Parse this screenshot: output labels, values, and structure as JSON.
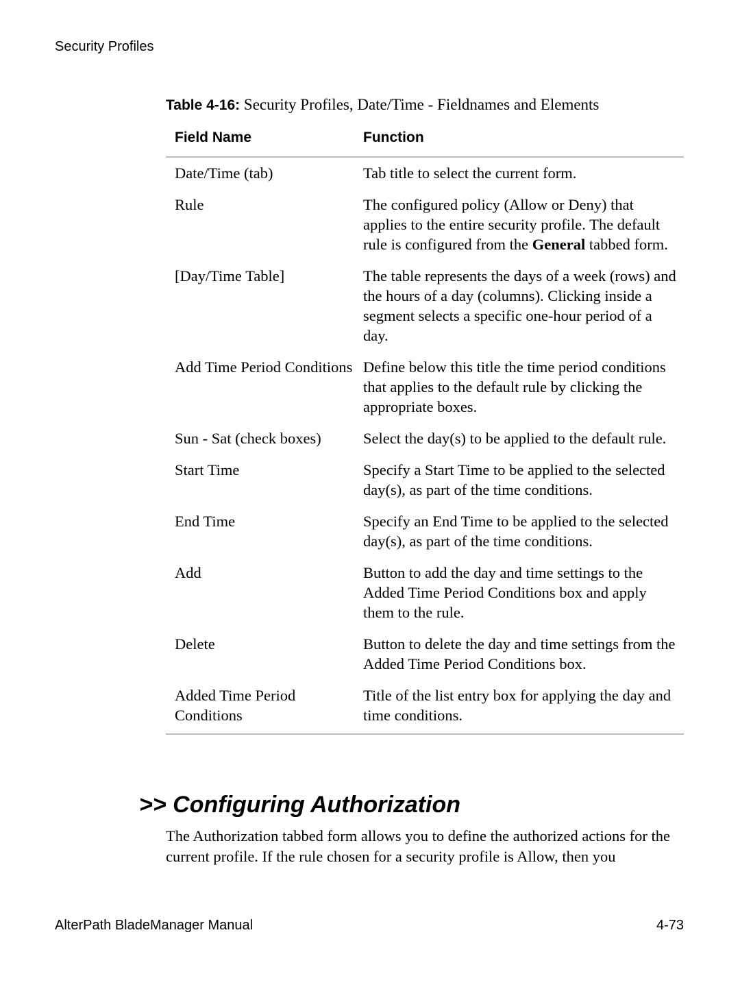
{
  "header": {
    "running_title": "Security Profiles"
  },
  "table": {
    "caption_label": "Table 4-16:",
    "caption_text": "Security Profiles, Date/Time - Fieldnames and Elements",
    "columns": [
      "Field Name",
      "Function"
    ],
    "rows": [
      {
        "field": "Date/Time (tab)",
        "function": "Tab title to select the current form."
      },
      {
        "field": "Rule",
        "function_parts": [
          "The configured policy (Allow or Deny) that applies to the entire security profile. The default rule is configured from the ",
          "General",
          " tabbed form."
        ]
      },
      {
        "field": "[Day/Time Table]",
        "function": "The table represents the days of a week (rows) and the hours of a day (columns). Clicking inside a segment selects a specific one-hour period of a day."
      },
      {
        "field": "Add Time Period Conditions",
        "function": "Define below this title the time period conditions that applies to the default rule by clicking the appropriate boxes."
      },
      {
        "field": "Sun - Sat (check boxes)",
        "function": "Select the day(s) to be applied to the default rule."
      },
      {
        "field": "Start Time",
        "function": "Specify a Start Time to be applied to the selected day(s), as part of the time conditions."
      },
      {
        "field": "End Time",
        "function": "Specify an End Time to be applied to the selected day(s), as part of the time conditions."
      },
      {
        "field": "Add",
        "function": "Button to add the day and time settings to the Added Time Period Conditions box and apply them to the rule."
      },
      {
        "field": "Delete",
        "function": "Button to delete the day and time settings from the Added Time Period Conditions box."
      },
      {
        "field": "Added Time Period Conditions",
        "function": "Title of the list entry box for applying the day and time conditions."
      }
    ]
  },
  "section": {
    "heading": ">> Configuring Authorization",
    "paragraph": "The Authorization tabbed form allows you to define the authorized actions for the current profile. If the rule chosen for a security profile is Allow, then you"
  },
  "footer": {
    "manual_title": "AlterPath BladeManager Manual",
    "page_number": "4-73"
  }
}
